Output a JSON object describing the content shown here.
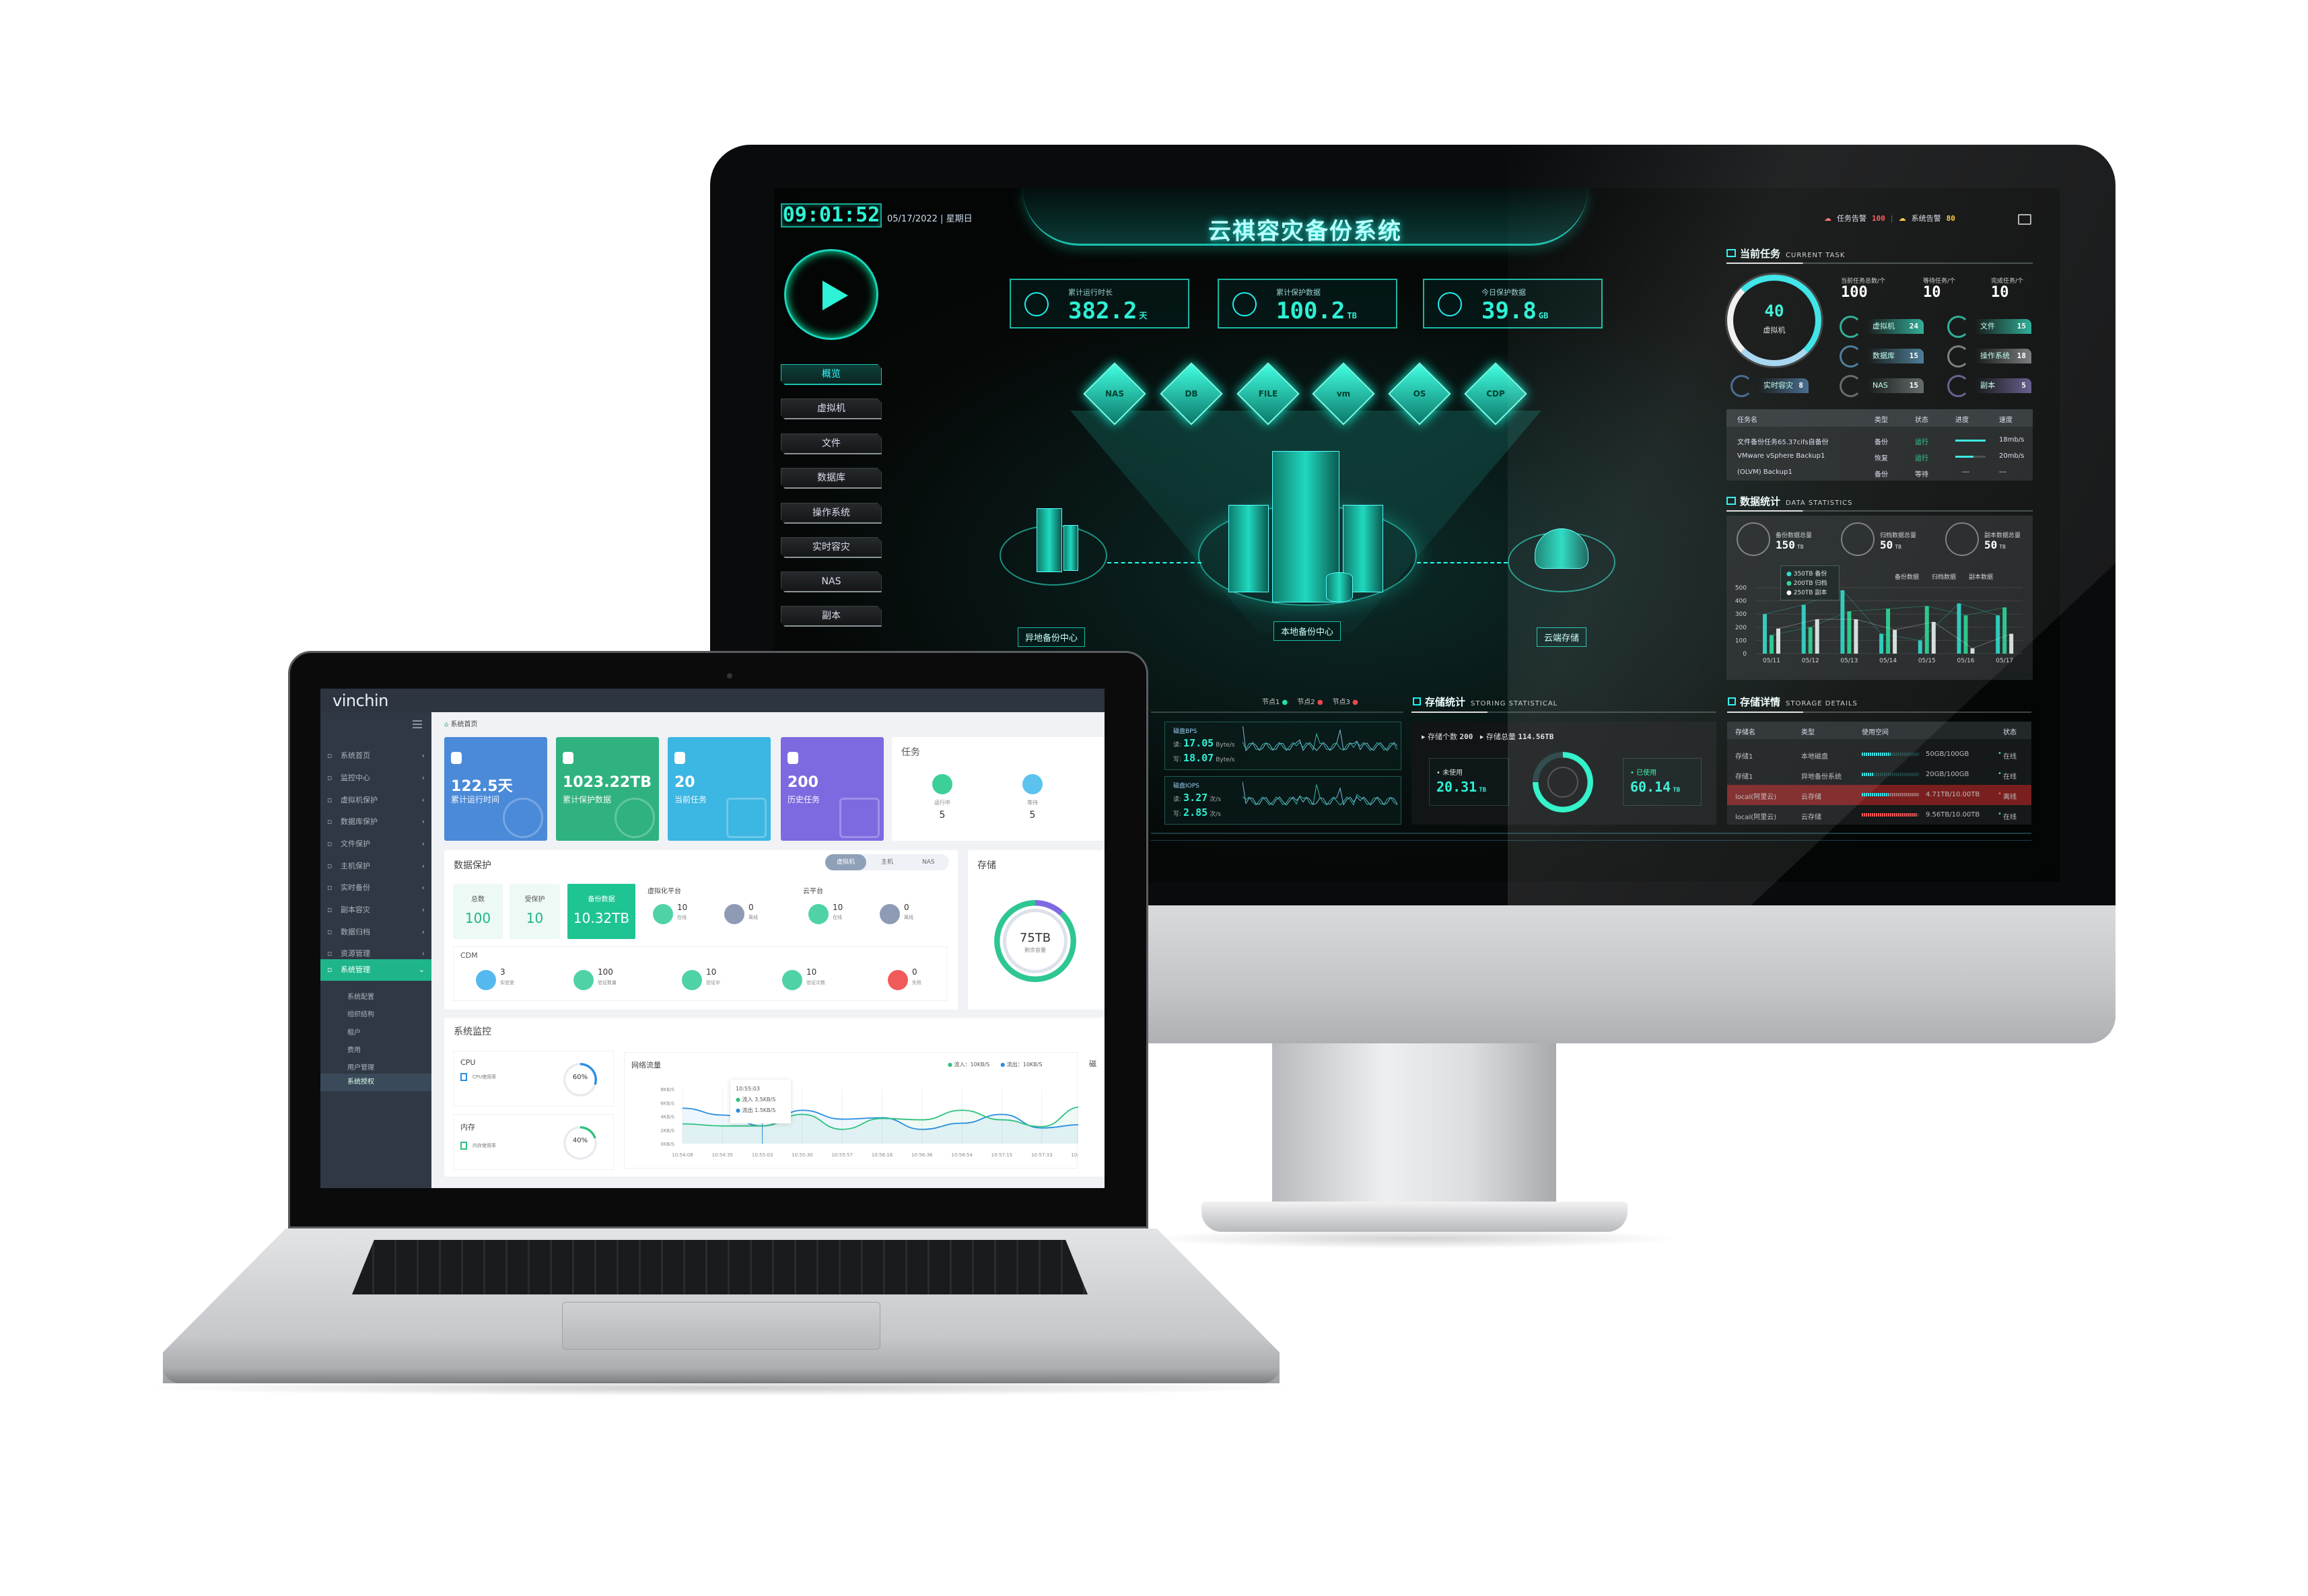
{
  "monitor": {
    "clock": "09:01:52",
    "date": "05/17/2022 | 星期日",
    "title": "云祺容灾备份系统",
    "nav": [
      "概览",
      "虚拟机",
      "文件",
      "数据库",
      "操作系统",
      "实时容灾",
      "NAS",
      "副本"
    ],
    "active_nav": "概览",
    "stats": [
      {
        "label": "累计运行时长",
        "value": "382.2",
        "unit": "天",
        "icon": "stopwatch-icon"
      },
      {
        "label": "累计保护数据",
        "value": "100.2",
        "unit": "TB",
        "icon": "bar-chart-icon"
      },
      {
        "label": "今日保护数据",
        "value": "39.8",
        "unit": "GB",
        "icon": "shield-check-icon"
      }
    ],
    "hex_icons": [
      "NAS",
      "DB",
      "FILE",
      "vm",
      "OS",
      "CDP"
    ],
    "centers": {
      "remote": "异地备份中心",
      "local": "本地备份中心",
      "cloud": "云端存储"
    },
    "alerts": {
      "task_label": "任务告警",
      "task_count": "100",
      "system_label": "系统告警",
      "system_count": "80"
    },
    "current_task": {
      "title": "当前任务",
      "subtitle": "CURRENT TASK",
      "gauge_value": "40",
      "gauge_label": "虚拟机",
      "totals": [
        {
          "label": "当前任务总数/个",
          "value": "100"
        },
        {
          "label": "等待任务/个",
          "value": "10"
        },
        {
          "label": "完成任务/个",
          "value": "10"
        }
      ],
      "pills": [
        {
          "label": "虚拟机",
          "value": "24",
          "color": "#1fa890"
        },
        {
          "label": "文件",
          "value": "15",
          "color": "#1fa890"
        },
        {
          "label": "数据库",
          "value": "15",
          "color": "#3d7390"
        },
        {
          "label": "操作系统",
          "value": "18",
          "color": "#6f7476"
        },
        {
          "label": "实时容灾",
          "value": "8",
          "color": "#385f86"
        },
        {
          "label": "NAS",
          "value": "15",
          "color": "#56605f"
        },
        {
          "label": "副本",
          "value": "5",
          "color": "#5c5486"
        }
      ],
      "table": {
        "headers": [
          "任务名",
          "类型",
          "状态",
          "进度",
          "速度"
        ],
        "rows": [
          {
            "name": "文件备份任务65.37cifs自备份",
            "type": "备份",
            "status": "运行",
            "progress": 1.0,
            "speed": "18mb/s"
          },
          {
            "name": "VMware vSphere Backup1",
            "type": "恢复",
            "status": "运行",
            "progress": 0.6,
            "speed": "20mb/s"
          },
          {
            "name": "(OLVM) Backup1",
            "type": "备份",
            "status": "等待",
            "progress_text": "---",
            "speed": "---"
          }
        ]
      }
    },
    "data_stats": {
      "title": "数据统计",
      "subtitle": "DATA STATISTICS",
      "totals": [
        {
          "label": "备份数据总量",
          "value": "150",
          "unit": "TB"
        },
        {
          "label": "归档数据总量",
          "value": "50",
          "unit": "TB"
        },
        {
          "label": "副本数据总量",
          "value": "50",
          "unit": "TB"
        }
      ],
      "tooltip": [
        "350TB 备份",
        "200TB 归档",
        "250TB 副本"
      ]
    },
    "nodes": [
      {
        "label": "节点1",
        "color": "#21e3a8"
      },
      {
        "label": "节点2",
        "color": "#f04848"
      },
      {
        "label": "节点3",
        "color": "#f04848"
      }
    ],
    "disk": {
      "bps": {
        "title": "磁盘BPS",
        "read_label": "读:",
        "read": "17.05",
        "write_label": "写:",
        "write": "18.07",
        "unit": "Byte/s"
      },
      "iops": {
        "title": "磁盘IOPS",
        "read_label": "读:",
        "read": "3.27",
        "write_label": "写:",
        "write": "2.85",
        "unit": "次/s"
      }
    },
    "storage_stat": {
      "title": "存储统计",
      "subtitle": "STORING STATISTICAL",
      "count_label": "存储个数",
      "count": "200",
      "total_label": "存储总量",
      "total": "114.56TB",
      "unused_label": "未使用",
      "unused": "20.31",
      "used_label": "已使用",
      "used": "60.14",
      "unit": "TB",
      "used_fraction": 0.75
    },
    "storage_details": {
      "title": "存储详情",
      "subtitle": "STORAGE DETAILS",
      "headers": [
        "存储名",
        "类型",
        "使用空间",
        "状态"
      ],
      "rows": [
        {
          "name": "存储1",
          "type": "本地磁盘",
          "usage": "50GB/100GB",
          "fraction": 0.5,
          "status": "在线",
          "alert": false
        },
        {
          "name": "存储1",
          "type": "异地备份系统",
          "usage": "20GB/100GB",
          "fraction": 0.2,
          "status": "在线",
          "alert": false
        },
        {
          "name": "local(阿里云)",
          "type": "云存储",
          "usage": "4.71TB/10.00TB",
          "fraction": 0.47,
          "status": "离线",
          "alert": true
        },
        {
          "name": "local(阿里云)",
          "type": "云存储",
          "usage": "9.56TB/10.00TB",
          "fraction": 0.96,
          "status": "在线",
          "alert": false
        }
      ]
    }
  },
  "chart_data": {
    "type": "bar",
    "categories": [
      "05/11",
      "05/12",
      "05/13",
      "05/14",
      "05/15",
      "05/16",
      "05/17"
    ],
    "series": [
      {
        "name": "备份数据",
        "values": [
          300,
          370,
          480,
          150,
          100,
          380,
          290
        ],
        "color": "#22d8c8"
      },
      {
        "name": "归档数据",
        "values": [
          140,
          200,
          320,
          340,
          360,
          290,
          350
        ],
        "color": "#1fd58f"
      },
      {
        "name": "副本数据",
        "values": [
          190,
          260,
          260,
          180,
          240,
          40,
          150
        ],
        "color": "#e8eeee"
      }
    ],
    "ylim": [
      0,
      500
    ],
    "yticks": [
      0,
      100,
      200,
      300,
      400,
      500
    ],
    "legend": "top-right",
    "grid": true
  },
  "laptop": {
    "logo": "vinchin",
    "breadcrumb": "系统首页",
    "sidebar": [
      "系统首页",
      "监控中心",
      "虚拟机保护",
      "数据库保护",
      "文件保护",
      "主机保护",
      "实时备份",
      "副本容灾",
      "数据归档",
      "资源管理",
      "系统管理"
    ],
    "sidebar_active": "系统管理",
    "submenu": [
      "系统配置",
      "组织结构",
      "租户",
      "费用",
      "用户管理",
      "系统授权"
    ],
    "submenu_active": "系统授权",
    "cards": [
      {
        "value": "122.5天",
        "label": "累计运行时间",
        "color": "#4a8ad8"
      },
      {
        "value": "1023.22TB",
        "label": "累计保护数据",
        "color": "#2fb27f"
      },
      {
        "value": "20",
        "label": "当前任务",
        "color": "#3cb6e2"
      },
      {
        "value": "200",
        "label": "历史任务",
        "color": "#7e6ae0"
      }
    ],
    "tasks": {
      "title": "任务",
      "items": [
        {
          "label": "运行中",
          "value": "5",
          "color": "#3ccf9a"
        },
        {
          "label": "等待",
          "value": "5",
          "color": "#5cc3ef"
        }
      ]
    },
    "protection": {
      "title": "数据保护",
      "tabs": [
        "虚拟机",
        "主机",
        "NAS"
      ],
      "active_tab": "虚拟机",
      "total_label": "总数",
      "total": "100",
      "protected_label": "受保护",
      "protected": "10",
      "backup_label": "备份数据",
      "backup": "10.32TB",
      "virt": {
        "title": "虚拟化平台",
        "online": "10",
        "online_label": "在线",
        "offline": "0",
        "offline_label": "离线"
      },
      "cloud": {
        "title": "云平台",
        "online": "10",
        "online_label": "在线",
        "offline": "0",
        "offline_label": "离线"
      },
      "cdm": {
        "title": "CDM",
        "items": [
          {
            "value": "3",
            "label": "实验室",
            "color": "#55b9f0"
          },
          {
            "value": "100",
            "label": "验证数量",
            "color": "#4fd3a6"
          },
          {
            "value": "10",
            "label": "验证中",
            "color": "#4fd3a6"
          },
          {
            "value": "10",
            "label": "验证次数",
            "color": "#4fd3a6"
          },
          {
            "value": "0",
            "label": "失败",
            "color": "#ef5b5b"
          }
        ]
      }
    },
    "storage": {
      "title": "存储",
      "value": "75TB",
      "label": "剩余容量",
      "used_fraction": 0.12
    },
    "monitor": {
      "title": "系统监控",
      "cpu": {
        "title": "CPU",
        "label": "CPU使用率",
        "value": "60%",
        "fraction": 0.6
      },
      "mem": {
        "title": "内存",
        "label": "内存使用率",
        "value": "40%",
        "fraction": 0.4
      },
      "partial_title": "磁",
      "network": {
        "title": "网络流量",
        "legend": [
          {
            "name": "流入：10KB/S",
            "color": "#2ec27e"
          },
          {
            "name": "流出：10KB/S",
            "color": "#2a8ee0"
          }
        ],
        "x": [
          "10:54:08",
          "10:54:35",
          "10:55:03",
          "10:55:30",
          "10:55:57",
          "10:56:16",
          "10:56:36",
          "10:56:54",
          "10:57:15",
          "10:57:33",
          "10:57:51"
        ],
        "yticks": [
          "0KB/S",
          "2KB/S",
          "4KB/S",
          "6KB/S",
          "8KB/S"
        ],
        "inflow": [
          2.9,
          2.6,
          2.6,
          4.3,
          2.1,
          3.7,
          3.5,
          4.9,
          3.5,
          2.5,
          5.4
        ],
        "outflow": [
          5.2,
          4.2,
          2.6,
          4.9,
          3.6,
          3.8,
          2.1,
          3.0,
          4.3,
          2.3,
          2.8
        ],
        "tooltip": {
          "time": "10:55:03",
          "in": "流入  3.5KB/S",
          "out": "流出  1.5KB/S"
        }
      }
    }
  }
}
